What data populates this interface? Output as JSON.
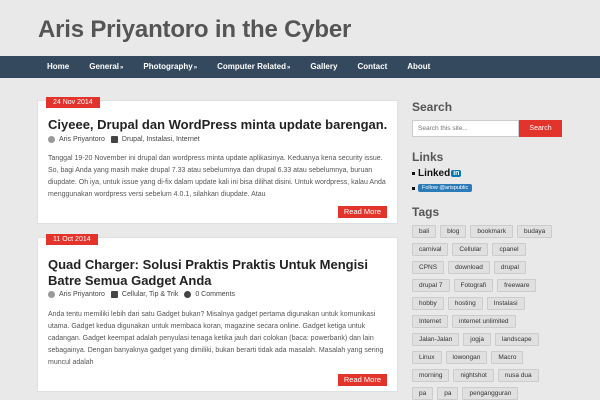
{
  "site": {
    "title": "Aris Priyantoro in the Cyber"
  },
  "nav": [
    {
      "label": "Home",
      "arrow": ""
    },
    {
      "label": "General",
      "arrow": "»"
    },
    {
      "label": "Photography",
      "arrow": "»"
    },
    {
      "label": "Computer Related",
      "arrow": "»"
    },
    {
      "label": "Gallery",
      "arrow": ""
    },
    {
      "label": "Contact",
      "arrow": ""
    },
    {
      "label": "About",
      "arrow": ""
    }
  ],
  "posts": [
    {
      "date": "24 Nov 2014",
      "title": "Ciyeee, Drupal dan WordPress minta update barengan.",
      "author": "Aris Priyantoro",
      "categories": "Drupal, Instalasi, Internet",
      "comments": "",
      "excerpt": "Tanggal 19-20 November ini drupal dan wordpress minta update aplikasinya. Keduanya kena security issue. So, bagi Anda yang masih make drupal 7.33 atau sebelumnya dan drupal 6.33 atau sebelumnya, buruan diupdate. Oh iya, untuk issue yang di-fix dalam update kali ini bisa dilihat disini. Untuk wordpress, kalau Anda menggunakan wordpress versi sebelum 4.0.1, silahkan diupdate. Atau",
      "readmore": "Read More"
    },
    {
      "date": "11 Oct 2014",
      "title": "Quad Charger: Solusi Praktis Praktis Untuk Mengisi Batre Semua Gadget Anda",
      "author": "Aris Priyantoro",
      "categories": "Cellular, Tip & Trik",
      "comments": "0 Comments",
      "excerpt": "Anda tentu memiliki lebih dari satu Gadget bukan? Misalnya gadget pertama digunakan untuk komunikasi utama. Gadget kedua digunakan untuk membaca koran, magazine secara online. Gadget ketiga untuk cadangan. Gadget keempat adalah penyulasi tenaga ketika jauh dari colokan (baca: powerbank) dan lain sebagainya. Dengan banyaknya gadget yang dimiliki, bukan berarti tidak ada masalah. Masalah yang sering muncul adalah",
      "readmore": "Read More"
    }
  ],
  "sidebar": {
    "search_title": "Search",
    "search_placeholder": "Search this site...",
    "search_button": "Search",
    "links_title": "Links",
    "linkedin_label": "Linked",
    "linkedin_in": "in",
    "twitter_label": "Follow @arispublic",
    "tags_title": "Tags",
    "tags": [
      "bali",
      "blog",
      "bookmark",
      "budaya",
      "carnival",
      "Cellular",
      "cpanel",
      "CPNS",
      "download",
      "drupal",
      "drupal 7",
      "Fotografi",
      "freeware",
      "hobby",
      "hosting",
      "Instalasi",
      "Internet",
      "internet unlimited",
      "Jalan-Jalan",
      "jogja",
      "landscape",
      "Linux",
      "lowongan",
      "Macro",
      "morning",
      "nightshot",
      "nusa dua",
      "pa",
      "pa",
      "pengangguran"
    ]
  }
}
